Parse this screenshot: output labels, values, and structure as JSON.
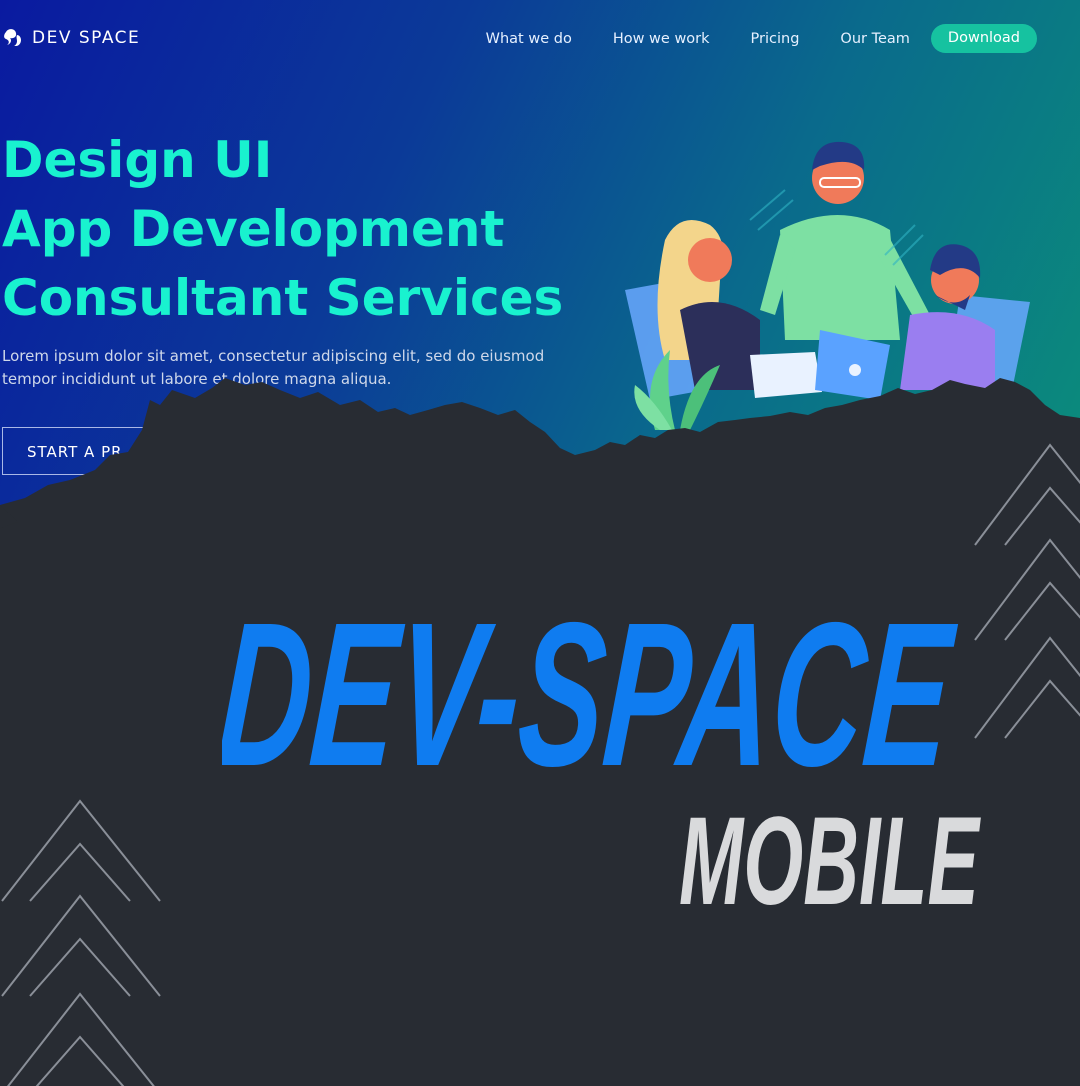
{
  "header": {
    "logo_text": "DEV SPACE",
    "nav": [
      "What we do",
      "How we work",
      "Pricing",
      "Our Team"
    ],
    "download_label": "Download"
  },
  "hero": {
    "headline": [
      "Design UI",
      "App Development",
      "Consultant Services"
    ],
    "subtitle": "Lorem ipsum dolor sit amet, consectetur adipiscing elit, sed do eiusmod tempor incididunt ut labore et dolore magna aliqua.",
    "cta_label": "START A PR"
  },
  "overlay": {
    "title": "DEV-SPACE",
    "subtitle": "MOBILE"
  },
  "colors": {
    "accent": "#19f2cf",
    "button": "#16c2a0",
    "title_blue": "#0f7cf0",
    "dark_bg": "#282c33"
  },
  "icons": [
    "squirrel-logo-icon",
    "chevron-up-icon"
  ]
}
